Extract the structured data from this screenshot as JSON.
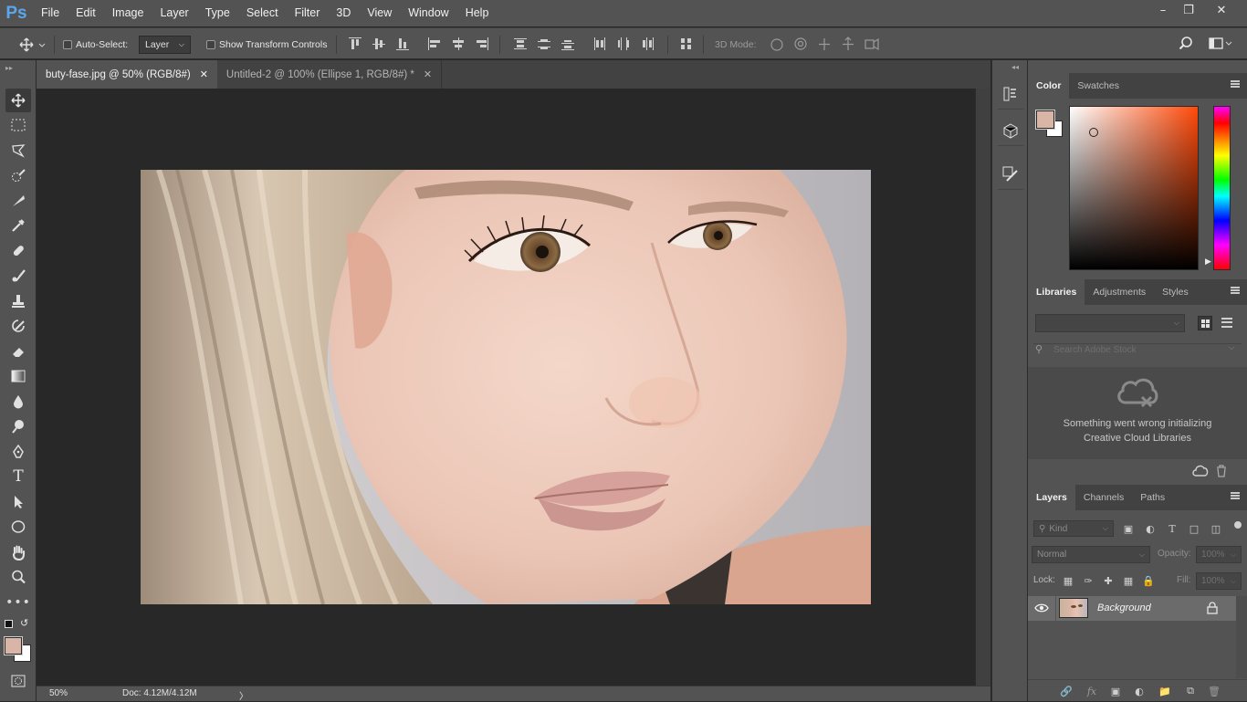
{
  "app": {
    "logo": "Ps"
  },
  "menu": [
    "File",
    "Edit",
    "Image",
    "Layer",
    "Type",
    "Select",
    "Filter",
    "3D",
    "View",
    "Window",
    "Help"
  ],
  "window_controls": {
    "minimize": "–",
    "restore": "❐",
    "close": "✕"
  },
  "options": {
    "auto_select_label": "Auto-Select:",
    "auto_select_value": "Layer",
    "transform_label": "Show Transform Controls",
    "mode_3d_label": "3D Mode:"
  },
  "tabs": [
    {
      "label": "buty-fase.jpg @ 50% (RGB/8#)",
      "active": true
    },
    {
      "label": "Untitled-2 @ 100% (Ellipse 1, RGB/8#) *",
      "active": false
    }
  ],
  "status": {
    "zoom": "50%",
    "doc": "Doc: 4.12M/4.12M",
    "arrow": "〉"
  },
  "colors": {
    "foreground": "#d9b5a8",
    "background": "#ffffff",
    "hue_base": "#ff4a0a"
  },
  "color_panel": {
    "tabs": [
      "Color",
      "Swatches"
    ]
  },
  "libraries_panel": {
    "tabs": [
      "Libraries",
      "Adjustments",
      "Styles"
    ],
    "search_placeholder": "Search Adobe Stock",
    "error_line1": "Something went wrong initializing",
    "error_line2": "Creative Cloud Libraries"
  },
  "layers_panel": {
    "tabs": [
      "Layers",
      "Channels",
      "Paths"
    ],
    "kind_label": "Kind",
    "blend_mode": "Normal",
    "opacity_label": "Opacity:",
    "opacity_value": "100%",
    "lock_label": "Lock:",
    "fill_label": "Fill:",
    "fill_value": "100%",
    "layers": [
      {
        "name": "Background",
        "visible": true,
        "locked": true
      }
    ]
  },
  "footer_icons": [
    "link-icon",
    "fx-icon",
    "mask-icon",
    "adjustment-icon",
    "folder-icon",
    "new-layer-icon",
    "trash-icon"
  ]
}
